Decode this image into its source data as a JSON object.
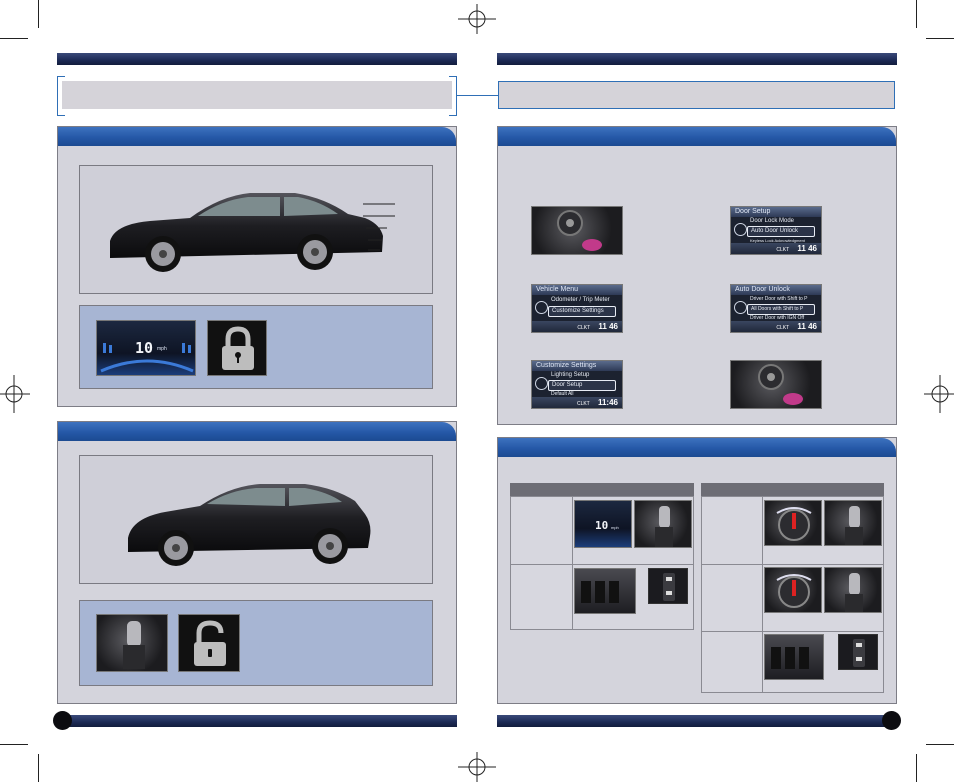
{
  "left_page": {
    "gauge_screen": {
      "speed_value": "10",
      "speed_unit": "mph"
    }
  },
  "right_page": {
    "menu_screens": [
      {
        "title": "Vehicle Menu",
        "rows": [
          "Odometer / Trip Meter",
          "Customize Settings"
        ],
        "selected": 1,
        "status_label": "CLKT",
        "time": "11 46"
      },
      {
        "title": "Customize Settings",
        "rows": [
          "Lighting Setup",
          "Door Setup",
          "Default All"
        ],
        "selected": 1,
        "status_label": "CLKT",
        "time": "11:46"
      },
      {
        "title": "Door Setup",
        "rows": [
          "Door Lock Mode",
          "Auto Door Unlock",
          "Keyless Lock Acknowledgment"
        ],
        "selected": 1,
        "status_label": "CLKT",
        "time": "11 46"
      },
      {
        "title": "Auto Door Unlock",
        "rows": [
          "Driver Door with Shift to P",
          "All Doors with Shift to P",
          "Driver Door with IGN Off"
        ],
        "selected": 1,
        "status_label": "CLKT",
        "time": "11 46"
      }
    ],
    "table_gauge": {
      "speed_value": "10",
      "speed_unit": "mph"
    }
  },
  "colors": {
    "navy": "#1c2a55",
    "section_blue": "#2558a7",
    "panel_gray": "#cfcfd8",
    "panel_blue": "#a7b5d3",
    "connector_blue": "#2f6fb6"
  },
  "icons": [
    "lock-closed-icon",
    "lock-open-icon",
    "menu-dial-icon"
  ]
}
